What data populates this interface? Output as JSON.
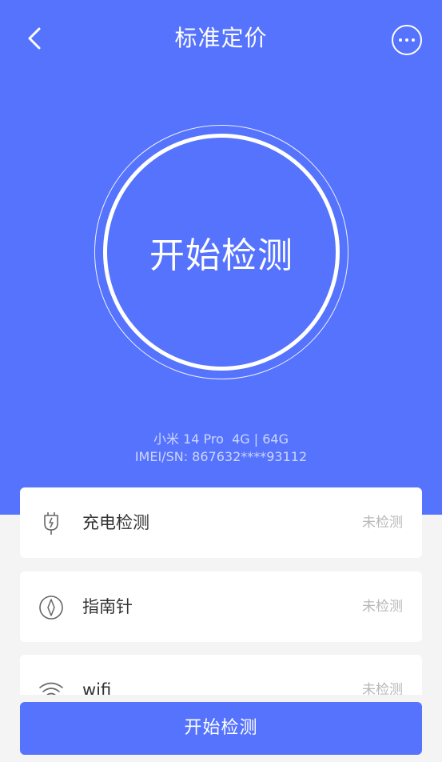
{
  "header": {
    "title": "标准定价",
    "back_icon": "chevron-left-icon",
    "more_icon": "more-icon"
  },
  "main": {
    "start_circle_label": "开始检测",
    "device_model": "小米 14 Pro  4G | 64G",
    "device_imei": "IMEI/SN: 867632****93112"
  },
  "checks": [
    {
      "label": "充电检测",
      "status": "未检测",
      "icon": "charging-plug-icon"
    },
    {
      "label": "指南针",
      "status": "未检测",
      "icon": "compass-icon"
    },
    {
      "label": "wifi",
      "status": "未检测",
      "icon": "wifi-icon"
    }
  ],
  "footer": {
    "start_button_label": "开始检测"
  },
  "colors": {
    "primary": "#5573fd",
    "background": "#f4f4f4",
    "status_text": "#b8b8b8"
  }
}
